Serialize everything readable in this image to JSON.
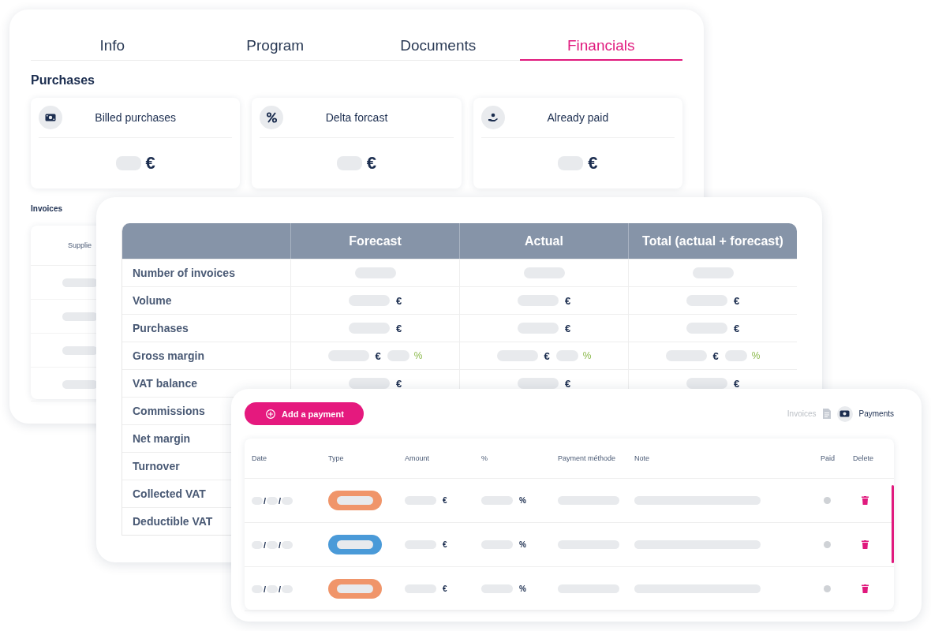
{
  "tabs": [
    {
      "label": "Info",
      "selected": false
    },
    {
      "label": "Program",
      "selected": false
    },
    {
      "label": "Documents",
      "selected": false
    },
    {
      "label": "Financials",
      "selected": true
    }
  ],
  "purchases": {
    "title": "Purchases",
    "stats": [
      {
        "kind": "banknote",
        "title": "Billed purchases",
        "currency": "€"
      },
      {
        "kind": "percent",
        "title": "Delta forcast",
        "currency": "€"
      },
      {
        "kind": "hand",
        "title": "Already paid",
        "currency": "€"
      }
    ]
  },
  "invoices": {
    "title": "Invoices",
    "columns": [
      "Supplie"
    ]
  },
  "summary_table": {
    "columns": [
      "Forecast",
      "Actual",
      "Total (actual + forecast)"
    ],
    "rows": [
      {
        "label": "Number of invoices",
        "cells": [
          {
            "kind": "count"
          },
          {
            "kind": "count"
          },
          {
            "kind": "count"
          }
        ]
      },
      {
        "label": "Volume",
        "cells": [
          {
            "kind": "amount",
            "currency": "€"
          },
          {
            "kind": "amount",
            "currency": "€"
          },
          {
            "kind": "amount",
            "currency": "€"
          }
        ]
      },
      {
        "label": "Purchases",
        "cells": [
          {
            "kind": "amount",
            "currency": "€"
          },
          {
            "kind": "amount",
            "currency": "€"
          },
          {
            "kind": "amount",
            "currency": "€"
          }
        ]
      },
      {
        "label": "Gross margin",
        "cells": [
          {
            "kind": "margin",
            "currency": "€",
            "percent": "%"
          },
          {
            "kind": "margin",
            "currency": "€",
            "percent": "%"
          },
          {
            "kind": "margin",
            "currency": "€",
            "percent": "%"
          }
        ]
      },
      {
        "label": "VAT balance",
        "cells": [
          {
            "kind": "amount",
            "currency": "€"
          },
          {
            "kind": "amount",
            "currency": "€"
          },
          {
            "kind": "amount",
            "currency": "€"
          }
        ]
      },
      {
        "label": "Commissions"
      },
      {
        "label": "Net margin"
      },
      {
        "label": "Turnover"
      },
      {
        "label": "Collected VAT"
      },
      {
        "label": "Deductible VAT"
      }
    ]
  },
  "payments": {
    "add_button": "Add a payment",
    "views": [
      {
        "label": "Invoices",
        "selected": false
      },
      {
        "label": "Payments",
        "selected": true
      }
    ],
    "columns": [
      "Date",
      "Type",
      "Amount",
      "%",
      "Payment méthode",
      "Note",
      "Paid",
      "Delete"
    ],
    "rows": [
      {
        "date_separators": [
          "/",
          "/"
        ],
        "color": "#f0956a",
        "currency": "€",
        "percent": "%"
      },
      {
        "date_separators": [
          "/",
          "/"
        ],
        "color": "#4a9ad8",
        "currency": "€",
        "percent": "%"
      },
      {
        "date_separators": [
          "/",
          "/"
        ],
        "color": "#f0956a",
        "currency": "€",
        "percent": "%"
      }
    ]
  }
}
